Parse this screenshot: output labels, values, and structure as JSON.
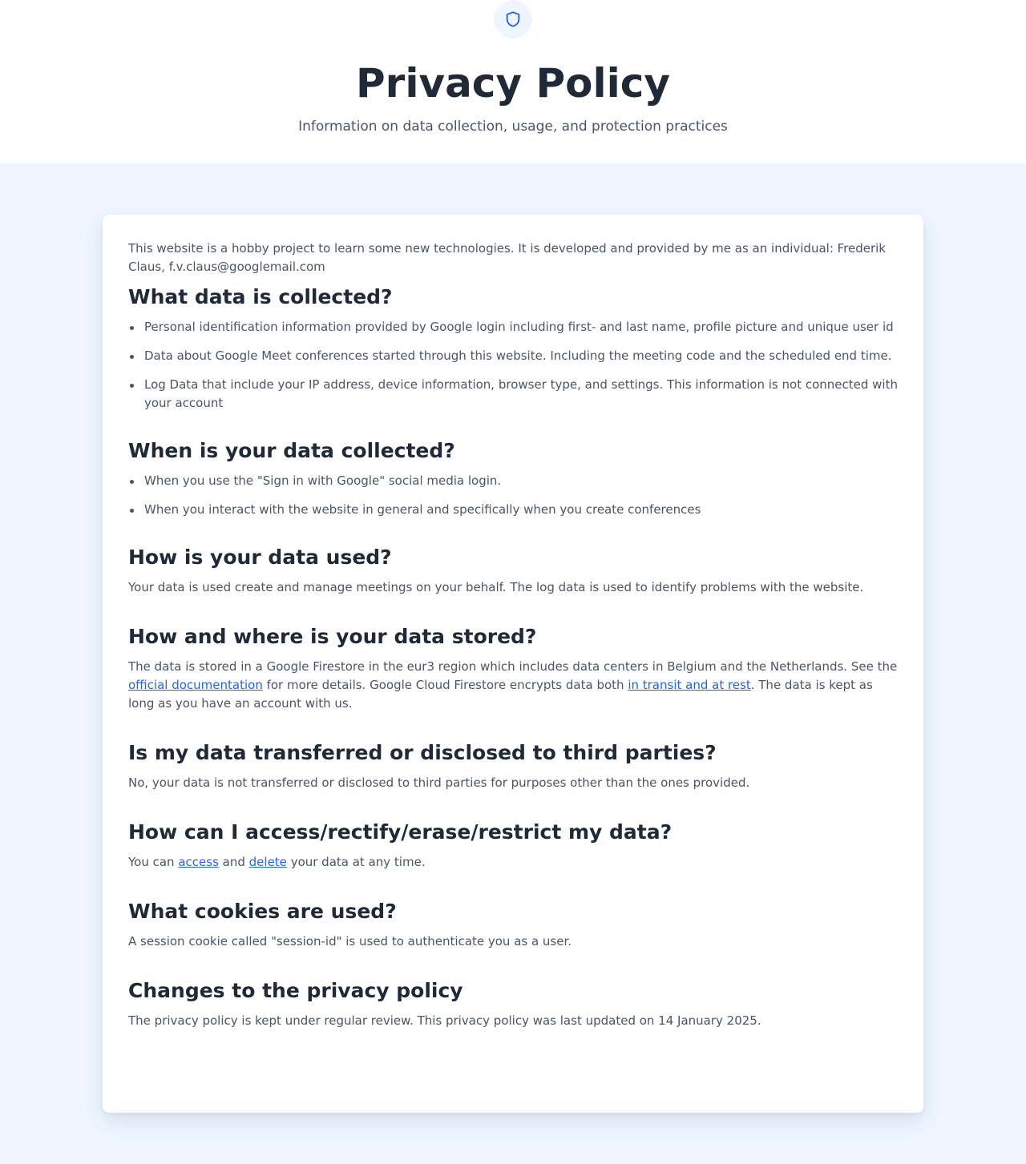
{
  "header": {
    "title": "Privacy Policy",
    "subtitle": "Information on data collection, usage, and protection practices",
    "icon": "shield-icon",
    "accent_color": "#2563eb"
  },
  "intro": {
    "text": "This website is a hobby project to learn some new technologies. It is developed and provided by me as an individual: Frederik Claus, f.v.claus@googlemail.com"
  },
  "sections": {
    "collected": {
      "heading": "What data is collected?",
      "items": [
        "Personal identification information provided by Google login including first- and last name, profile picture and unique user id",
        "Data about Google Meet conferences started through this website. Including the meeting code and the scheduled end time.",
        "Log Data that include your IP address, device information, browser type, and settings. This information is not connected with your account"
      ]
    },
    "when": {
      "heading": "When is your data collected?",
      "items": [
        "When you use the \"Sign in with Google\" social media login.",
        "When you interact with the website in general and specifically when you create conferences"
      ]
    },
    "used": {
      "heading": "How is your data used?",
      "text": "Your data is used create and manage meetings on your behalf. The log data is used to identify problems with the website."
    },
    "stored": {
      "heading": "How and where is your data stored?",
      "text_1": "The data is stored in a Google Firestore in the eur3 region which includes data centers in Belgium and the Netherlands. See the ",
      "link_1": "official documentation",
      "text_2": " for more details. Google Cloud Firestore encrypts data both ",
      "link_2": "in transit and at rest",
      "text_3": ". The data is kept as long as you have an account with us."
    },
    "third_parties": {
      "heading": "Is my data transferred or disclosed to third parties?",
      "text": "No, your data is not transferred or disclosed to third parties for purposes other than the ones provided."
    },
    "access": {
      "heading": "How can I access/rectify/erase/restrict my data?",
      "text_1": "You can ",
      "link_access": "access",
      "text_2": " and ",
      "link_delete": "delete",
      "text_3": " your data at any time."
    },
    "cookies": {
      "heading": "What cookies are used?",
      "text": "A session cookie called \"session-id\" is used to authenticate you as a user."
    },
    "changes": {
      "heading": "Changes to the privacy policy",
      "text": "The privacy policy is kept under regular review. This privacy policy was last updated on 14 January 2025."
    }
  }
}
